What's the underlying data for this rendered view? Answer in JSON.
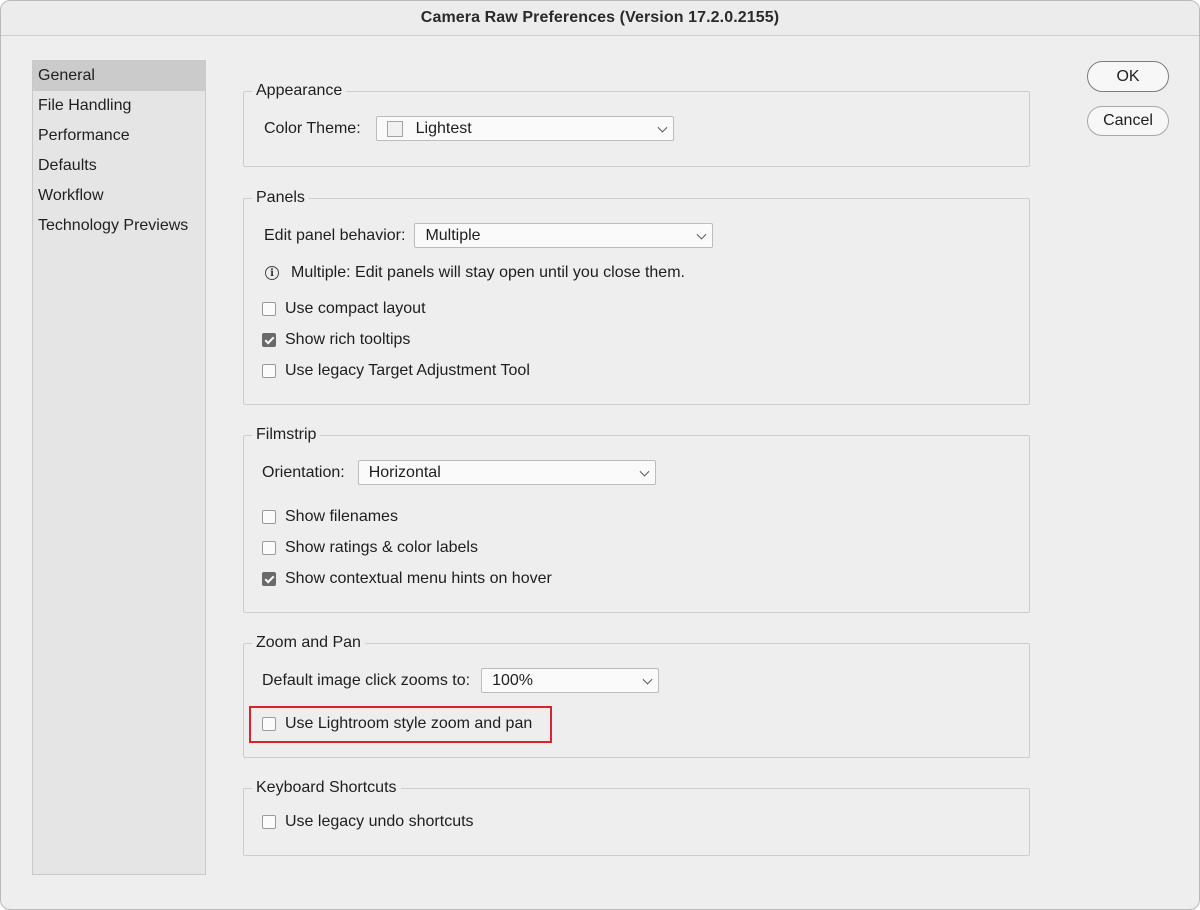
{
  "window": {
    "title": "Camera Raw Preferences  (Version 17.2.0.2155)"
  },
  "sidebar": {
    "items": [
      {
        "label": "General",
        "selected": true
      },
      {
        "label": "File Handling"
      },
      {
        "label": "Performance"
      },
      {
        "label": "Defaults"
      },
      {
        "label": "Workflow"
      },
      {
        "label": "Technology Previews"
      }
    ]
  },
  "buttons": {
    "ok": "OK",
    "cancel": "Cancel"
  },
  "appearance": {
    "legend": "Appearance",
    "color_theme_label": "Color Theme:",
    "color_theme_value": "Lightest"
  },
  "panels": {
    "legend": "Panels",
    "edit_behavior_label": "Edit panel behavior:",
    "edit_behavior_value": "Multiple",
    "info_text": "Multiple: Edit panels will stay open until you close them.",
    "compact_layout": {
      "label": "Use compact layout",
      "checked": false
    },
    "rich_tooltips": {
      "label": "Show rich tooltips",
      "checked": true
    },
    "legacy_target": {
      "label": "Use legacy Target Adjustment Tool",
      "checked": false
    }
  },
  "filmstrip": {
    "legend": "Filmstrip",
    "orientation_label": "Orientation:",
    "orientation_value": "Horizontal",
    "show_filenames": {
      "label": "Show filenames",
      "checked": false
    },
    "show_ratings": {
      "label": "Show ratings & color labels",
      "checked": false
    },
    "menu_hints": {
      "label": "Show contextual menu hints on hover",
      "checked": true
    }
  },
  "zoom": {
    "legend": "Zoom and Pan",
    "default_zoom_label": "Default image click zooms to:",
    "default_zoom_value": "100%",
    "lightroom_style": {
      "label": "Use Lightroom style zoom and pan",
      "checked": false
    }
  },
  "keyboard": {
    "legend": "Keyboard Shortcuts",
    "legacy_undo": {
      "label": "Use legacy undo shortcuts",
      "checked": false
    }
  },
  "colors": {
    "highlight": "#d9252a",
    "selected_sidebar": "#cbcbcb",
    "window_bg": "#eeeeee"
  }
}
